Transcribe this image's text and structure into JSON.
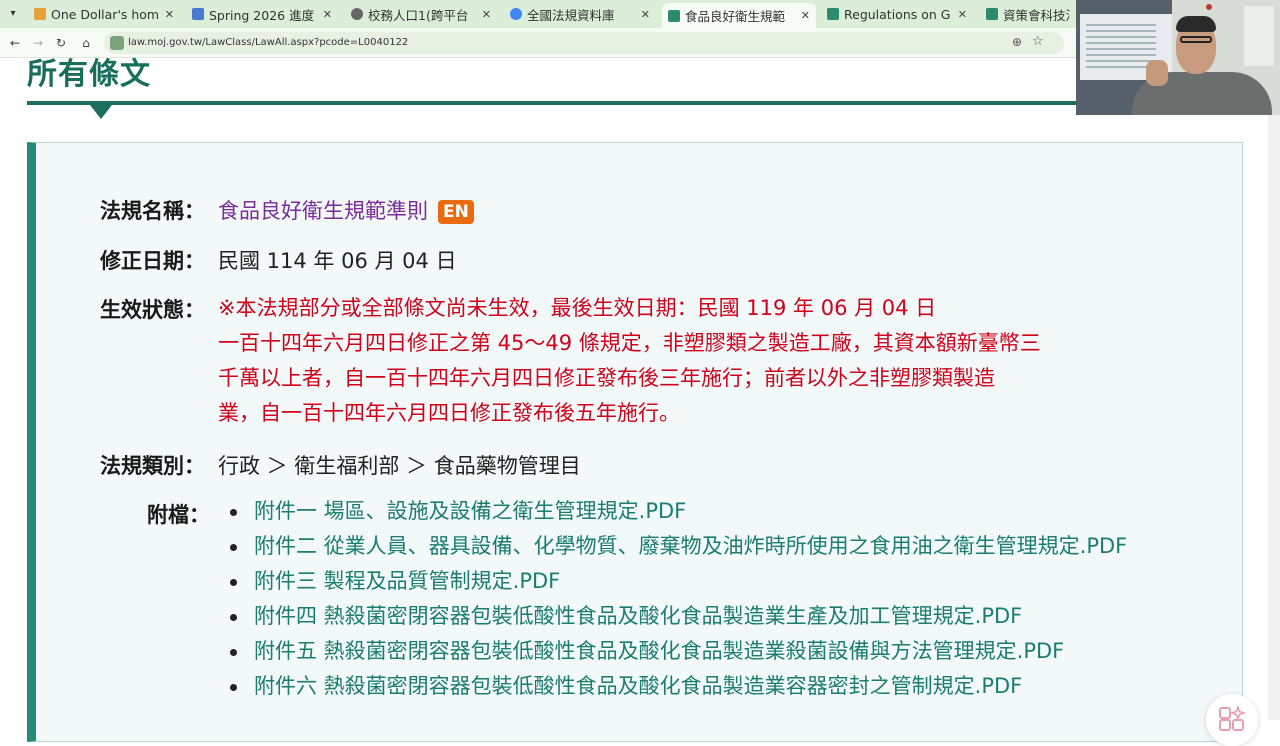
{
  "browser": {
    "tabs": [
      {
        "title": "One Dollar's hom",
        "favicon_color": "#e8a23a"
      },
      {
        "title": "Spring 2026 進度",
        "favicon_color": "#4a7bd0"
      },
      {
        "title": "校務人口1(跨平台",
        "favicon_color": "#666666"
      },
      {
        "title": "全國法規資料庫",
        "favicon_color": "#4285f4"
      },
      {
        "title": "食品良好衛生規範",
        "favicon_color": "#2d8a6f"
      },
      {
        "title": "Regulations on G",
        "favicon_color": "#2d8a6f"
      },
      {
        "title": "資策會科技法律",
        "favicon_color": "#2d8a6f"
      }
    ],
    "url": "law.moj.gov.tw/LawClass/LawAll.aspx?pcode=L0040122"
  },
  "page": {
    "section_title": "所有條文",
    "rows": {
      "name_label": "法規名稱：",
      "name_value": "食品良好衛生規範準則",
      "en_badge": "EN",
      "date_label": "修正日期：",
      "date_value": "民國 114 年 06 月 04 日",
      "status_label": "生效狀態：",
      "status_lines": [
        "※本法規部分或全部條文尚未生效，最後生效日期：民國 119 年 06 月 04 日",
        "一百十四年六月四日修正之第 45～49 條規定，非塑膠類之製造工廠，其資本額新臺幣三",
        "千萬以上者，自一百十四年六月四日修正發布後三年施行；前者以外之非塑膠類製造",
        "業，自一百十四年六月四日修正發布後五年施行。"
      ],
      "category_label": "法規類別：",
      "category_value": "行政 ＞ 衛生福利部 ＞ 食品藥物管理目",
      "attach_label": "附檔："
    },
    "attachments": [
      "附件一 場區、設施及設備之衛生管理規定.PDF",
      "附件二 從業人員、器具設備、化學物質、廢棄物及油炸時所使用之食用油之衛生管理規定.PDF",
      "附件三 製程及品質管制規定.PDF",
      "附件四 熱殺菌密閉容器包裝低酸性食品及酸化食品製造業生產及加工管理規定.PDF",
      "附件五 熱殺菌密閉容器包裝低酸性食品及酸化食品製造業殺菌設備與方法管理規定.PDF",
      "附件六 熱殺菌密閉容器包裝低酸性食品及酸化食品製造業容器密封之管制規定.PDF"
    ]
  },
  "colors": {
    "accent": "#1c6e5d",
    "law_name": "#7b2b9a",
    "status_red": "#d0021b",
    "link": "#1a7d6e",
    "en_badge": "#ea6a11"
  }
}
